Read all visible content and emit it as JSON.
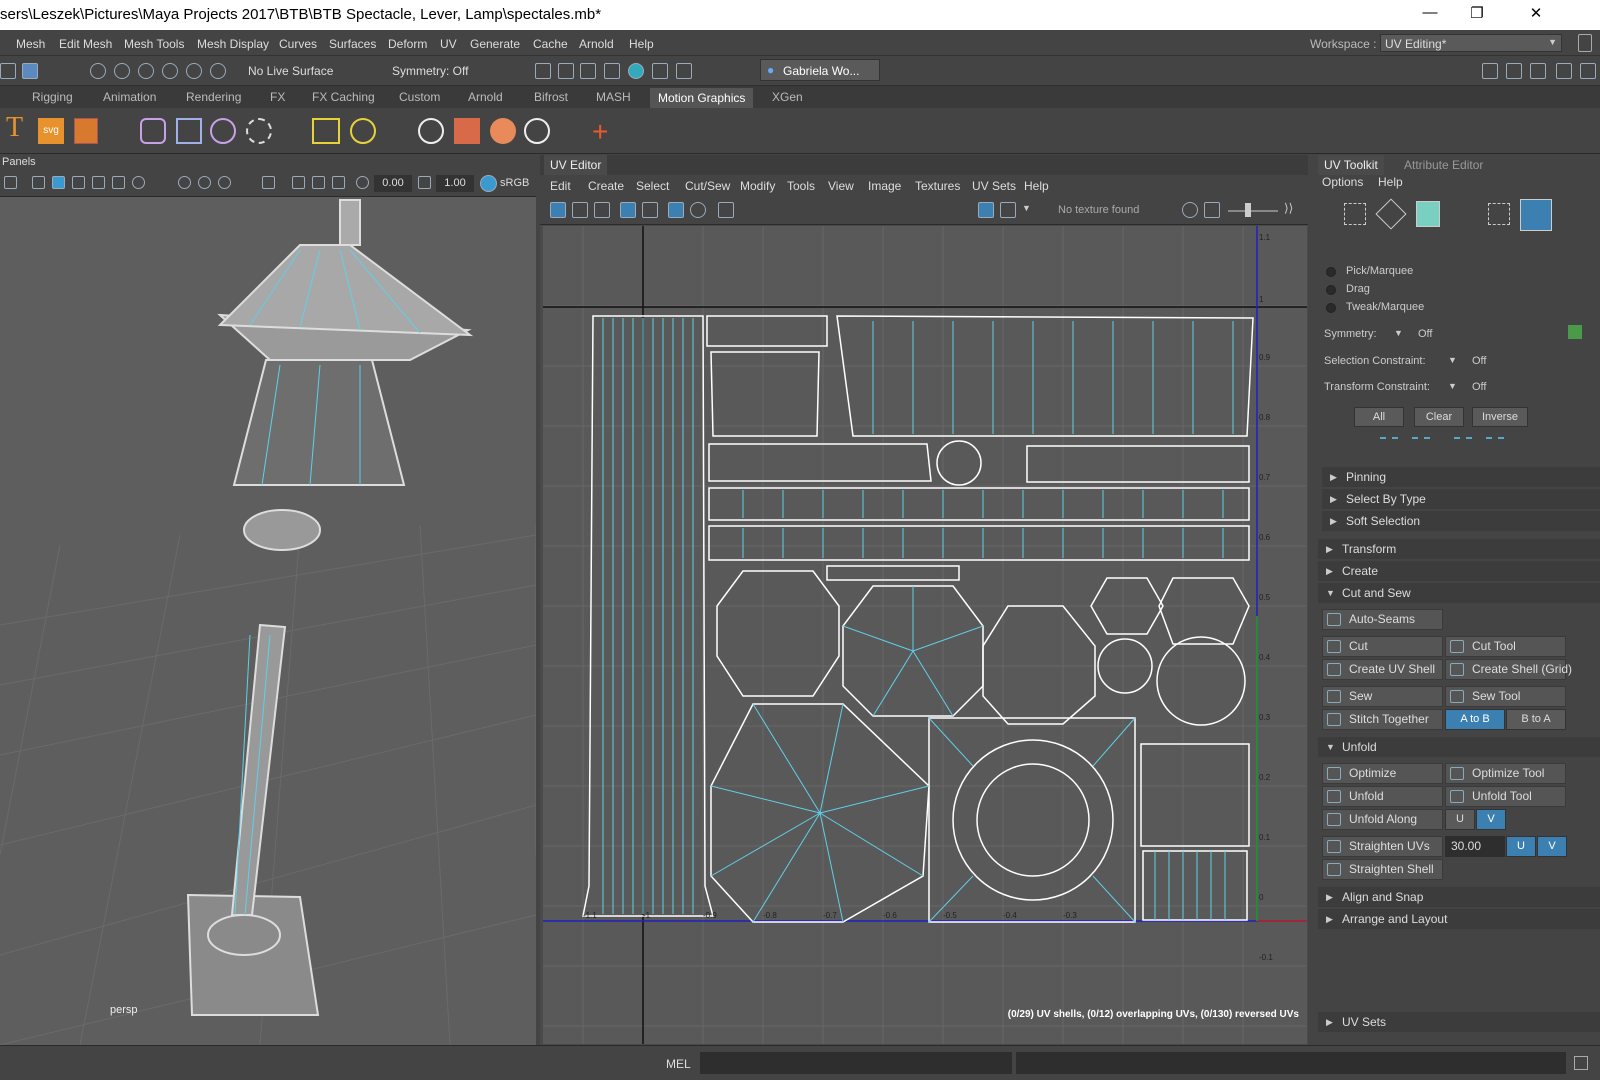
{
  "window": {
    "title": "sers\\Leszek\\Pictures\\Maya Projects 2017\\BTB\\BTB Spectacle, Lever, Lamp\\spectales.mb*",
    "minimize": "—",
    "maximize": "❐",
    "close": "✕"
  },
  "menubar": {
    "items": [
      "Mesh",
      "Edit Mesh",
      "Mesh Tools",
      "Mesh Display",
      "Curves",
      "Surfaces",
      "Deform",
      "UV",
      "Generate",
      "Cache",
      "Arnold",
      "Help"
    ],
    "workspace_label": "Workspace :",
    "workspace_value": "UV Editing*"
  },
  "statusline": {
    "live_surface": "No Live Surface",
    "symmetry": "Symmetry: Off",
    "user": "Gabriela Wo..."
  },
  "shelf_tabs": [
    "Rigging",
    "Animation",
    "Rendering",
    "FX",
    "FX Caching",
    "Custom",
    "Arnold",
    "Bifrost",
    "MASH",
    "Motion Graphics",
    "XGen"
  ],
  "active_shelf_tab": "Motion Graphics",
  "viewport": {
    "panels_label": "Panels",
    "field_a": "0.00",
    "field_b": "1.00",
    "colorspace": "sRGB",
    "camera": "persp"
  },
  "uv_editor": {
    "title": "UV Editor",
    "menu": [
      "Edit",
      "Create",
      "Select",
      "Cut/Sew",
      "Modify",
      "Tools",
      "View",
      "Image",
      "Textures",
      "UV Sets",
      "Help"
    ],
    "texture_status": "No texture found",
    "axis_v": [
      "1.1",
      "1",
      "0.9",
      "0.8",
      "0.7",
      "0.6",
      "0.5",
      "0.4",
      "0.3",
      "0.2",
      "0.1",
      "0",
      "-0.1"
    ],
    "axis_u": [
      "-1.1",
      "-1",
      "-0.9",
      "-0.8",
      "-0.7",
      "-0.6",
      "-0.5",
      "-0.4",
      "-0.3"
    ],
    "footer": "(0/29) UV shells, (0/12) overlapping UVs, (0/130) reversed UVs"
  },
  "toolkit": {
    "tabs": [
      "UV Toolkit",
      "Attribute Editor"
    ],
    "menu": [
      "Options",
      "Help"
    ],
    "modes": [
      "Pick/Marquee",
      "Drag",
      "Tweak/Marquee"
    ],
    "symmetry_label": "Symmetry:",
    "symmetry_value": "Off",
    "sel_constraint_label": "Selection Constraint:",
    "sel_constraint_value": "Off",
    "xf_constraint_label": "Transform Constraint:",
    "xf_constraint_value": "Off",
    "buttons": {
      "all": "All",
      "clear": "Clear",
      "inverse": "Inverse"
    },
    "sections": {
      "pinning": "Pinning",
      "select_by_type": "Select By Type",
      "soft_selection": "Soft Selection",
      "transform": "Transform",
      "create": "Create",
      "cut_and_sew": "Cut and Sew",
      "unfold": "Unfold",
      "align_snap": "Align and Snap",
      "arrange": "Arrange and Layout",
      "uv_sets": "UV Sets"
    },
    "cutsew": {
      "auto_seams": "Auto-Seams",
      "cut": "Cut",
      "cut_tool": "Cut Tool",
      "create_uv_shell": "Create UV Shell",
      "create_shell_grid": "Create Shell (Grid)",
      "sew": "Sew",
      "sew_tool": "Sew Tool",
      "stitch": "Stitch Together",
      "a_to_b": "A to B",
      "b_to_a": "B to A"
    },
    "unfold": {
      "optimize": "Optimize",
      "optimize_tool": "Optimize Tool",
      "unfold": "Unfold",
      "unfold_tool": "Unfold Tool",
      "unfold_along": "Unfold Along",
      "u": "U",
      "v": "V",
      "straighten_uvs": "Straighten UVs",
      "straighten_value": "30.00",
      "straighten_shell": "Straighten Shell"
    }
  },
  "bottom": {
    "lang": "MEL"
  }
}
